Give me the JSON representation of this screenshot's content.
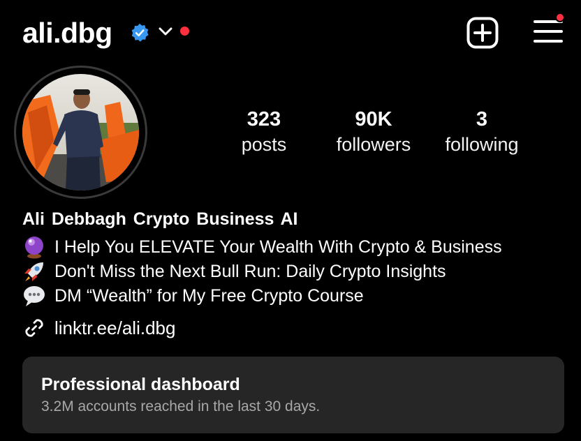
{
  "header": {
    "username": "ali.dbg",
    "verified": true,
    "icons": [
      "verified-badge-icon",
      "chevron-down-icon",
      "create-post-icon",
      "menu-icon"
    ],
    "colors": {
      "verified": "#3897f0",
      "notification": "#ff3040"
    }
  },
  "profile": {
    "stats": {
      "posts_value": "323",
      "posts_label": "posts",
      "followers_value": "90K",
      "followers_label": "followers",
      "following_value": "3",
      "following_label": "following"
    },
    "display_name": "Ali Debbagh  Crypto  Business  AI",
    "bio": [
      {
        "emoji": "crystal-ball-icon",
        "text": "I Help You ELEVATE Your Wealth With Crypto & Business"
      },
      {
        "emoji": "rocket-icon",
        "text": "Don't Miss the Next Bull Run: Daily Crypto Insights"
      },
      {
        "emoji": "speech-bubble-icon",
        "text": "DM “Wealth” for My Free Crypto Course"
      }
    ],
    "link": "linktr.ee/ali.dbg"
  },
  "dashboard": {
    "title": "Professional dashboard",
    "subtitle": "3.2M accounts reached in the last 30 days."
  }
}
